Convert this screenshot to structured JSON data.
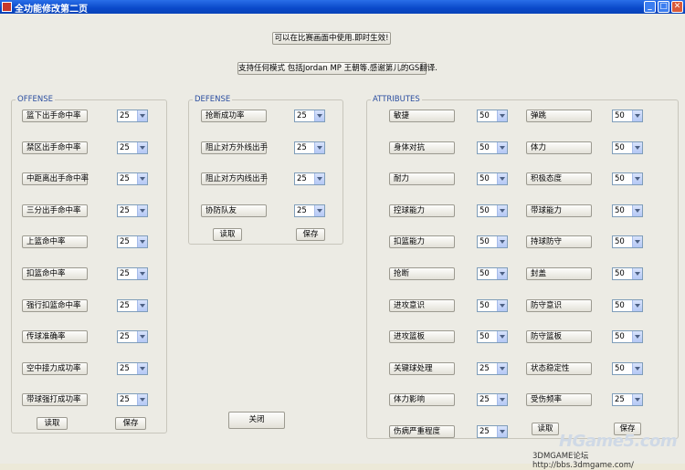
{
  "window": {
    "title": "全功能修改第二页"
  },
  "notices": {
    "line1": "可以在比赛画面中使用.即时生效!",
    "line2": "支持任何模式 包括Jordan MP 王朝等.感谢第儿的GS翻译."
  },
  "offense": {
    "label": "OFFENSE",
    "items": [
      {
        "label": "篮下出手命中率",
        "value": "25"
      },
      {
        "label": "禁区出手命中率",
        "value": "25"
      },
      {
        "label": "中距离出手命中率",
        "value": "25"
      },
      {
        "label": "三分出手命中率",
        "value": "25"
      },
      {
        "label": "上篮命中率",
        "value": "25"
      },
      {
        "label": "扣篮命中率",
        "value": "25"
      },
      {
        "label": "强行扣篮命中率",
        "value": "25"
      },
      {
        "label": "传球准确率",
        "value": "25"
      },
      {
        "label": "空中接力成功率",
        "value": "25"
      },
      {
        "label": "带球强打成功率",
        "value": "25"
      }
    ],
    "read_label": "读取",
    "save_label": "保存"
  },
  "defense": {
    "label": "DEFENSE",
    "items": [
      {
        "label": "抢断成功率",
        "value": "25"
      },
      {
        "label": "阻止对方外线出手",
        "value": "25"
      },
      {
        "label": "阻止对方内线出手",
        "value": "25"
      },
      {
        "label": "协防队友",
        "value": "25"
      }
    ],
    "read_label": "读取",
    "save_label": "保存"
  },
  "attributes": {
    "label": "ATTRIBUTES",
    "left": [
      {
        "label": "敏捷",
        "value": "50"
      },
      {
        "label": "身体对抗",
        "value": "50"
      },
      {
        "label": "耐力",
        "value": "50"
      },
      {
        "label": "控球能力",
        "value": "50"
      },
      {
        "label": "扣篮能力",
        "value": "50"
      },
      {
        "label": "抢断",
        "value": "50"
      },
      {
        "label": "进攻意识",
        "value": "50"
      },
      {
        "label": "进攻篮板",
        "value": "50"
      },
      {
        "label": "关键球处理",
        "value": "25"
      },
      {
        "label": "体力影响",
        "value": "25"
      },
      {
        "label": "伤病严重程度",
        "value": "25"
      }
    ],
    "right": [
      {
        "label": "弹跳",
        "value": "50"
      },
      {
        "label": "体力",
        "value": "50"
      },
      {
        "label": "积极态度",
        "value": "50"
      },
      {
        "label": "带球能力",
        "value": "50"
      },
      {
        "label": "持球防守",
        "value": "50"
      },
      {
        "label": "封盖",
        "value": "50"
      },
      {
        "label": "防守意识",
        "value": "50"
      },
      {
        "label": "防守篮板",
        "value": "50"
      },
      {
        "label": "状态稳定性",
        "value": "50"
      },
      {
        "label": "受伤频率",
        "value": "25"
      }
    ],
    "read_label": "读取",
    "save_label": "保存"
  },
  "close_label": "关闭",
  "watermark": "HGame5.com",
  "footer": "3DMGAME论坛 http://bbs.3dmgame.com/"
}
